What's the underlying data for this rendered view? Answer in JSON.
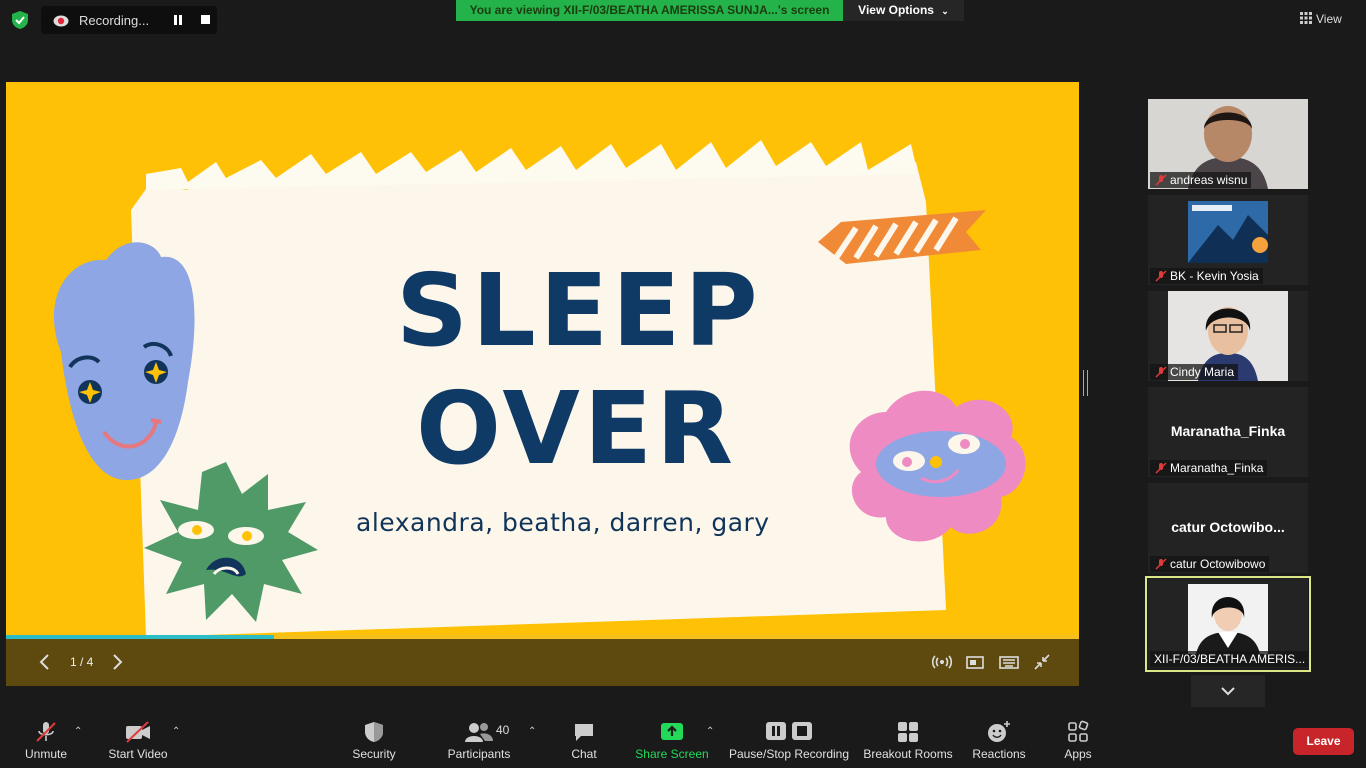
{
  "top_bar": {
    "recording_label": "Recording...",
    "viewing_banner": "You are viewing XII-F/03/BEATHA AMERISSA SUNJA...'s screen",
    "view_options_label": "View Options",
    "view_label": "View"
  },
  "slide": {
    "title_line1": "SLEEP",
    "title_line2": "OVER",
    "authors": "alexandra, beatha, darren, gary",
    "counter": "1 / 4",
    "progress": 0.25,
    "background_color": "#fec105"
  },
  "participants_panel": {
    "tiles": [
      {
        "name": "andreas wisnu",
        "muted": true,
        "type": "video"
      },
      {
        "name": "BK - Kevin Yosia",
        "muted": true,
        "type": "image"
      },
      {
        "name": "Cindy Maria",
        "muted": true,
        "type": "video"
      },
      {
        "name": "Maranatha_Finka",
        "big_name": "Maranatha_Finka",
        "muted": true,
        "type": "name"
      },
      {
        "name": "catur Octowibowo",
        "big_name": "catur  Octowibo...",
        "muted": true,
        "type": "name"
      },
      {
        "name": "XII-F/03/BEATHA AMERIS...",
        "muted": false,
        "type": "video",
        "active": true
      }
    ]
  },
  "toolbar": {
    "unmute": "Unmute",
    "start_video": "Start Video",
    "security": "Security",
    "participants": "Participants",
    "participants_count": "40",
    "chat": "Chat",
    "share_screen": "Share Screen",
    "pause_stop_recording": "Pause/Stop Recording",
    "breakout_rooms": "Breakout Rooms",
    "reactions": "Reactions",
    "apps": "Apps",
    "leave": "Leave"
  },
  "colors": {
    "banner_green": "#23b34a",
    "share_green": "#23d959",
    "leave_red": "#c8252b",
    "active_speaker": "#dbe684"
  }
}
